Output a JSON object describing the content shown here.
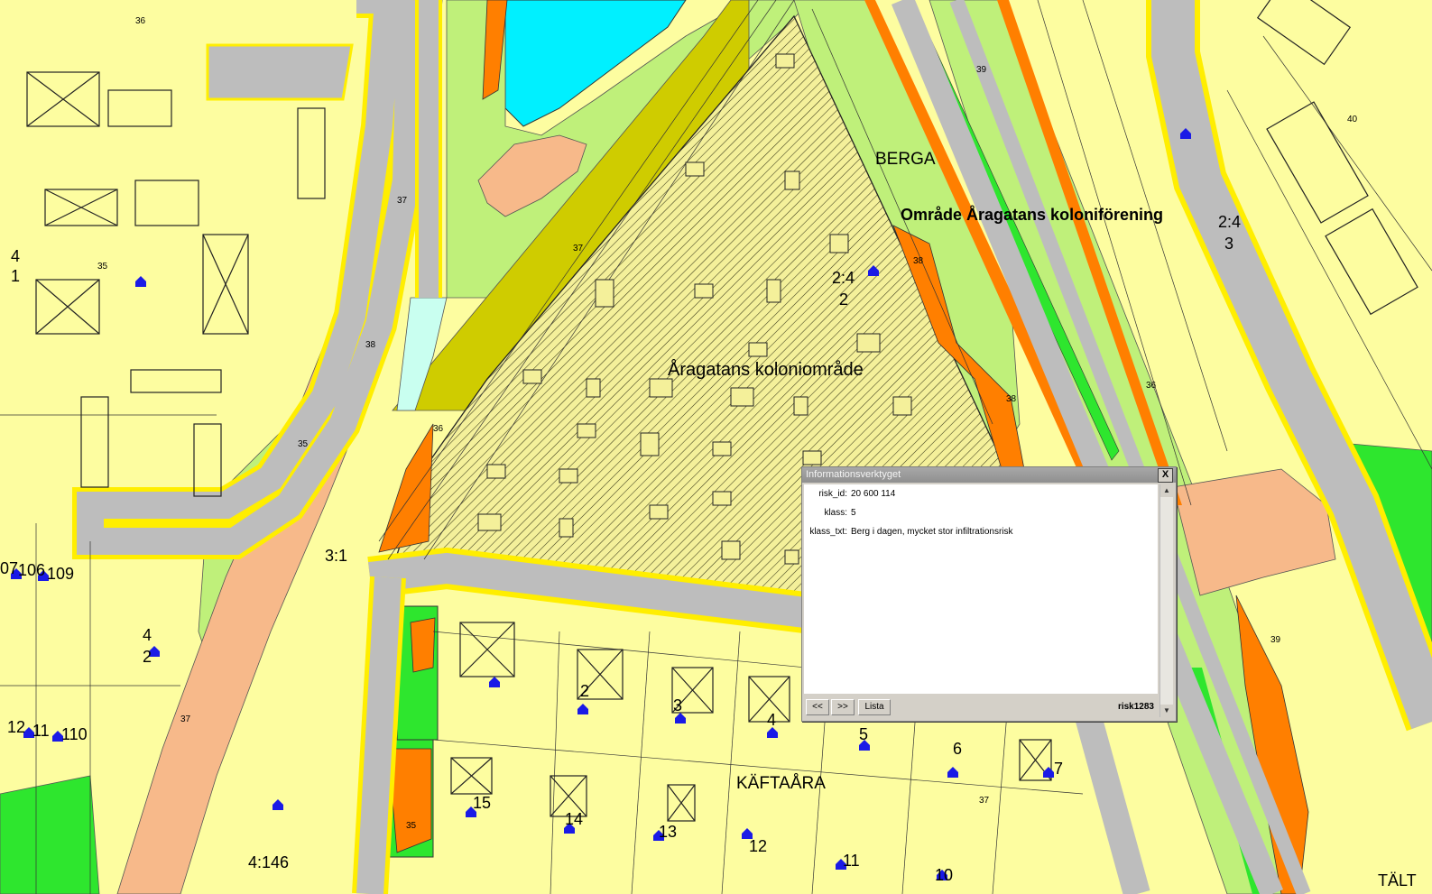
{
  "map": {
    "district_labels": {
      "berga": "BERGA",
      "association": "Område Åragatans koloniförening",
      "colony_area": "Åragatans koloniområde",
      "kaftaara": "KÄFTAÅRA",
      "talt": "TÄLT"
    },
    "parcel_labels": {
      "p_2_4_right": "2:4",
      "p_3_right": "3",
      "p_2_4_mid": "2:4",
      "p_2_mid": "2",
      "p_4_left": "4",
      "p_1_left": "1",
      "p_3_1": "3:1",
      "p_4_146": "4:146",
      "p_106": "106",
      "p_109": "109",
      "p_107": "07",
      "p_4b": "4",
      "p_2b": "2",
      "p_112": "12",
      "p_111": "11",
      "p_110": "110",
      "p_lot_2": "2",
      "p_lot_3": "3",
      "p_lot_4": "4",
      "p_lot_5": "5",
      "p_lot_6": "6",
      "p_lot_7": "7",
      "p_lot_15": "15",
      "p_lot_14": "14",
      "p_lot_13": "13",
      "p_lot_12": "12",
      "p_lot_11": "11",
      "p_lot_10": "10"
    },
    "contour_labels": [
      "36",
      "35",
      "37",
      "38",
      "36",
      "35",
      "37",
      "38",
      "39",
      "40",
      "39",
      "37",
      "36",
      "35",
      "38",
      "37"
    ],
    "colors": {
      "background": "#fdfda0",
      "road": "#bdbdbd",
      "road_edge": "#ffee00",
      "water": "#00f0ff",
      "grass": "#bff07a",
      "green_strong": "#2ee62e",
      "orange": "#ff7f00",
      "salmon": "#f7b98a",
      "olive": "#cfcc00",
      "pale_cyan": "#c9fff0",
      "house_icon": "#1a1ae6"
    }
  },
  "info_window": {
    "title": "Informationsverktyget",
    "close_label": "X",
    "fields": [
      {
        "key": "risk_id:",
        "value": "20 600 114"
      },
      {
        "key": "klass:",
        "value": "5"
      },
      {
        "key": "klass_txt:",
        "value": "Berg i dagen, mycket stor infiltrationsrisk"
      }
    ],
    "prev_label": "<<",
    "next_label": ">>",
    "list_label": "Lista",
    "feature_name": "risk1283"
  }
}
